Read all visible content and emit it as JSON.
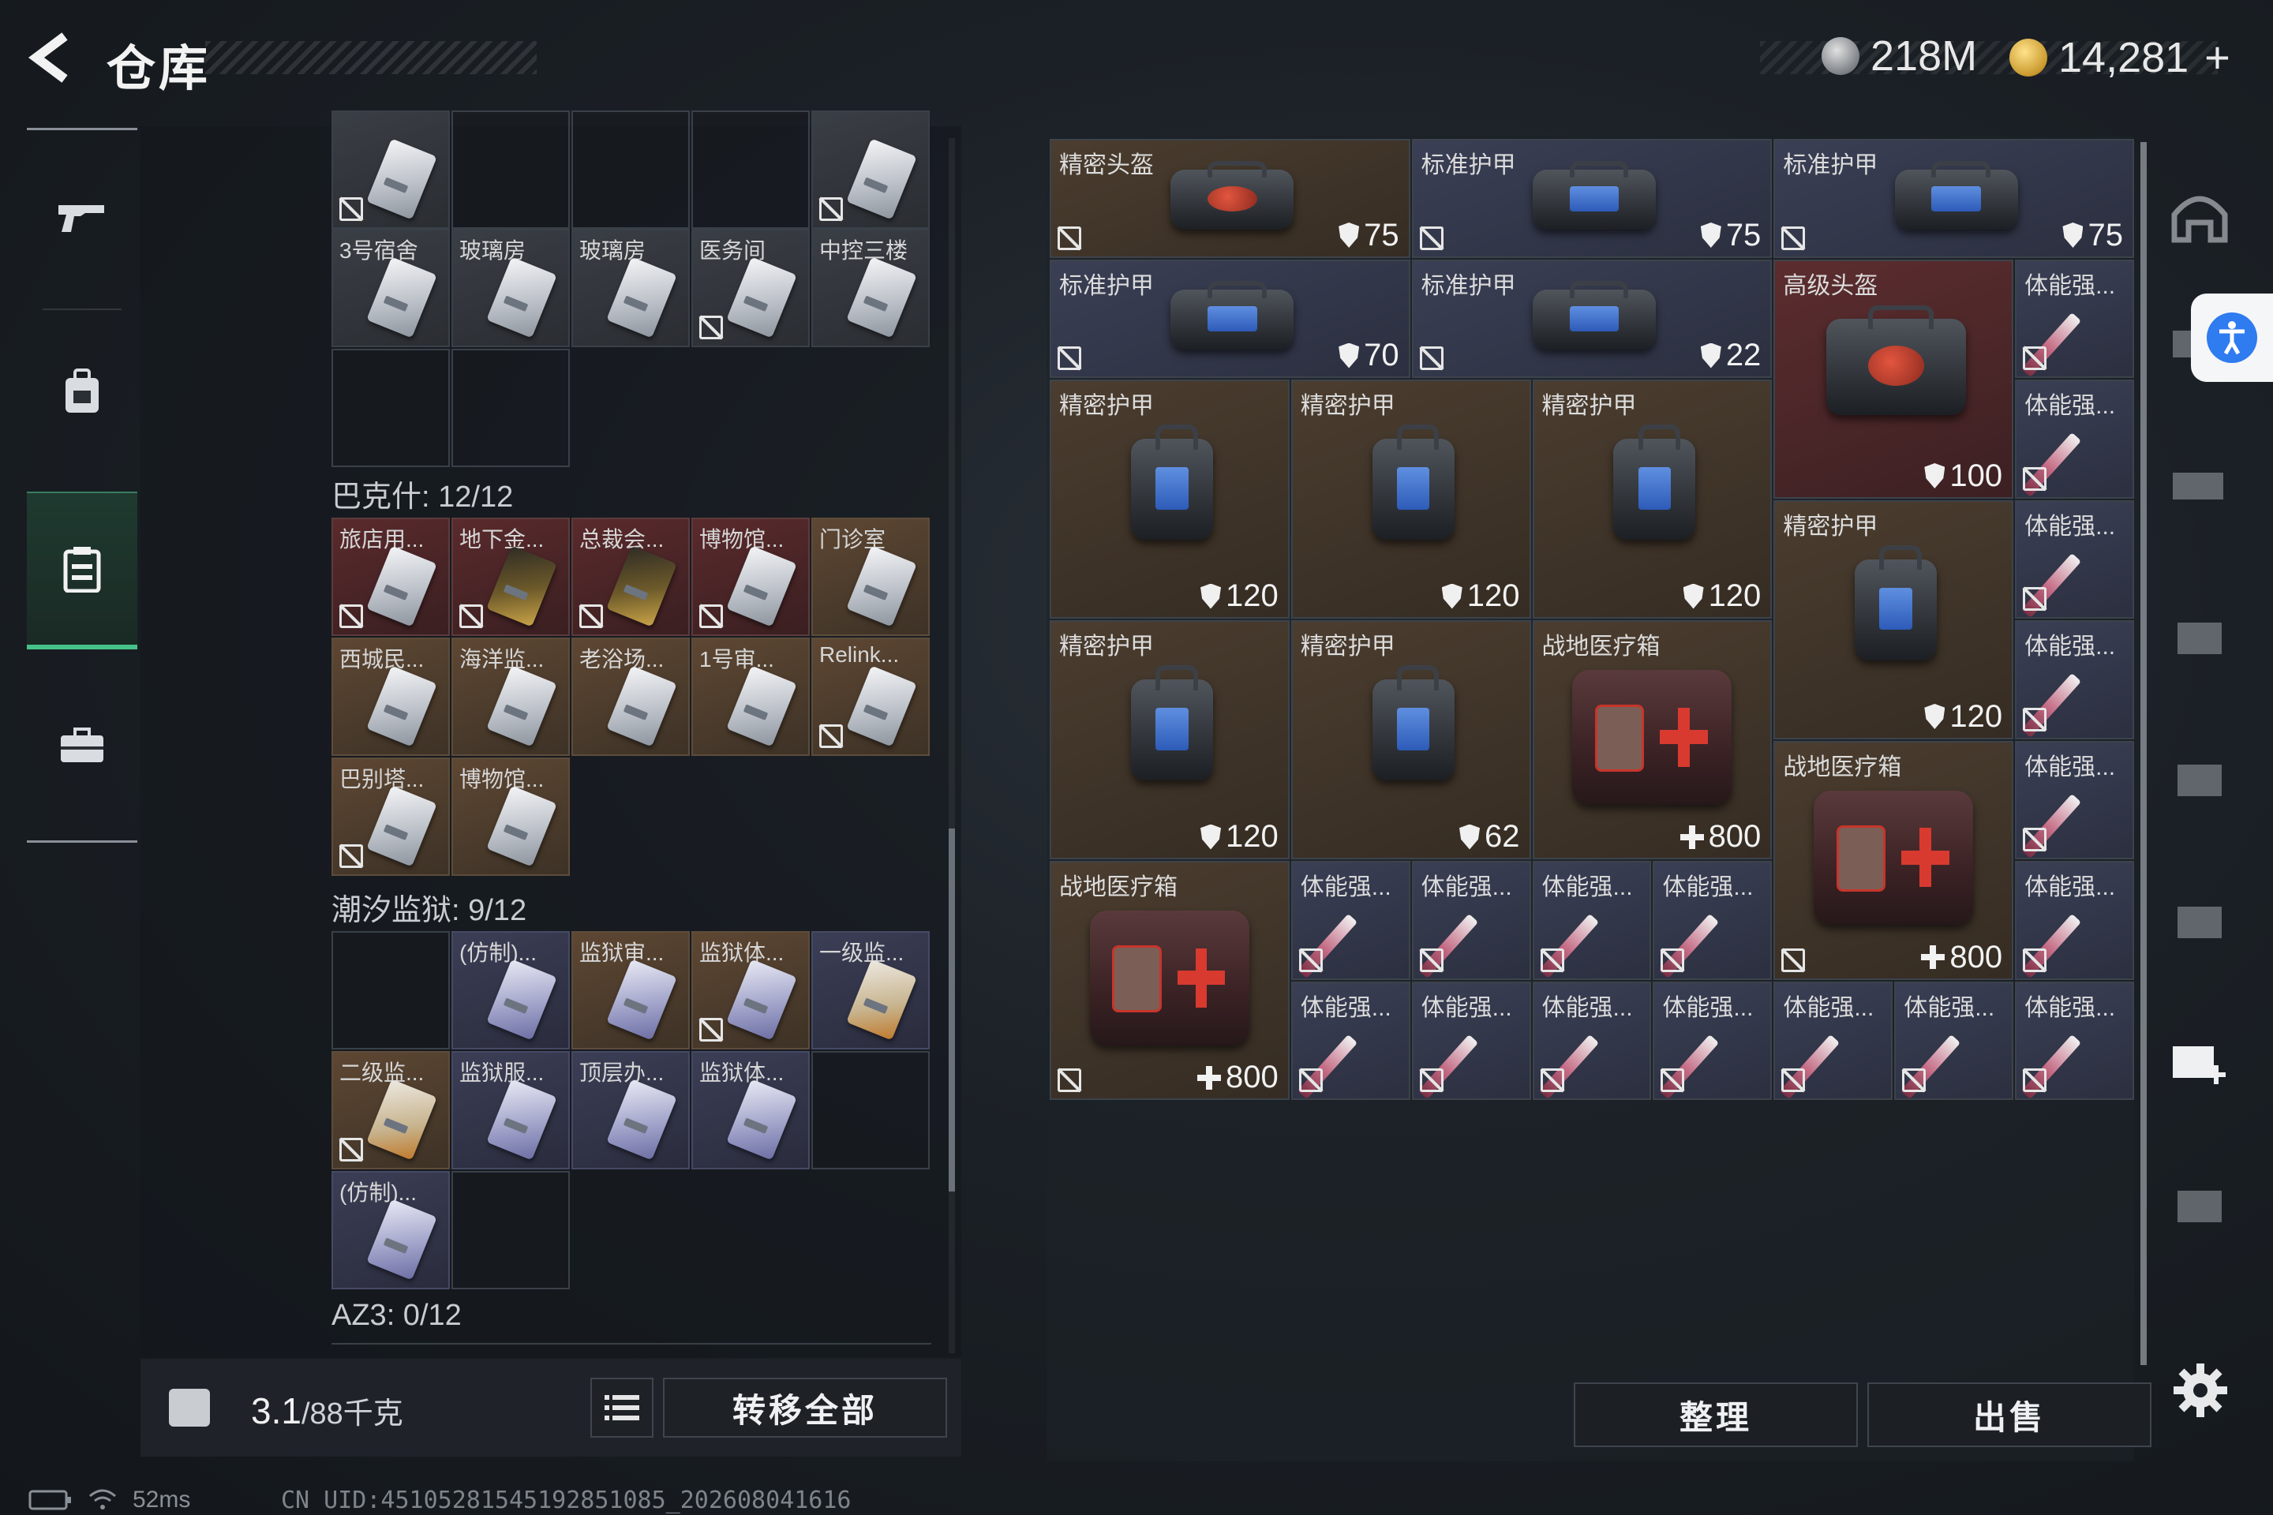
{
  "header": {
    "title": "仓库",
    "silver_amount": "218M",
    "gold_amount": "14,281",
    "plus_label": "+"
  },
  "left_nav": {
    "items": [
      {
        "icon": "gun-icon"
      },
      {
        "icon": "backpack-icon"
      },
      {
        "icon": "storage-icon",
        "active": true
      },
      {
        "icon": "briefcase-icon"
      }
    ]
  },
  "storage": {
    "top_cards": [
      {
        "label": "",
        "tint": "gray"
      },
      {
        "label": "",
        "tint": "empty"
      },
      {
        "label": "",
        "tint": "empty"
      },
      {
        "label": "",
        "tint": "empty"
      },
      {
        "label": "",
        "tint": "gray"
      },
      {
        "label": "3号宿舍",
        "tint": "gray"
      },
      {
        "label": "玻璃房",
        "tint": "gray"
      },
      {
        "label": "玻璃房",
        "tint": "gray"
      },
      {
        "label": "医务间",
        "tint": "gray"
      },
      {
        "label": "中控三楼",
        "tint": "gray"
      }
    ],
    "sections": [
      {
        "name": "巴克什: 12/12",
        "cards": [
          "旅店用...",
          "地下金...",
          "总裁会...",
          "博物馆...",
          "门诊室",
          "西城民...",
          "海洋监...",
          "老浴场...",
          "1号审...",
          "Relink...",
          "巴别塔...",
          "博物馆..."
        ]
      },
      {
        "name": "潮汐监狱: 9/12",
        "cards": [
          "(仿制)...",
          "监狱审...",
          "监狱体...",
          "一级监...",
          "二级监...",
          "监狱服...",
          "顶层办...",
          "监狱体...",
          "(仿制)..."
        ]
      },
      {
        "name": "AZ3: 0/12",
        "cards": []
      }
    ],
    "weight": "3.1",
    "weight_max": "/88千克",
    "transfer_all": "转移全部"
  },
  "status": {
    "ping": "52ms",
    "uid": "CN UID:4510528154519285108​5_202608041616"
  },
  "items": [
    {
      "label": "精密头盔",
      "value": "75",
      "kind": "shield",
      "tint": "brown"
    },
    {
      "label": "标准护甲",
      "value": "75",
      "kind": "shield",
      "tint": "blue"
    },
    {
      "label": "标准护甲",
      "value": "75",
      "kind": "shield",
      "tint": "blue"
    },
    {
      "label": "标准护甲",
      "value": "70",
      "kind": "shield",
      "tint": "blue"
    },
    {
      "label": "标准护甲",
      "value": "22",
      "kind": "shield",
      "tint": "blue"
    },
    {
      "label": "高级头盔",
      "value": "100",
      "kind": "shield",
      "tint": "red"
    },
    {
      "label": "精密护甲",
      "value": "120",
      "kind": "shield",
      "tint": "brown"
    },
    {
      "label": "精密护甲",
      "value": "120",
      "kind": "shield",
      "tint": "brown"
    },
    {
      "label": "精密护甲",
      "value": "120",
      "kind": "shield",
      "tint": "brown"
    },
    {
      "label": "精密护甲",
      "value": "120",
      "kind": "shield",
      "tint": "brown"
    },
    {
      "label": "精密护甲",
      "value": "120",
      "kind": "shield",
      "tint": "brown"
    },
    {
      "label": "精密护甲",
      "value": "62",
      "kind": "shield",
      "tint": "brown"
    },
    {
      "label": "战地医疗箱",
      "value": "800",
      "kind": "med",
      "tint": "brown"
    },
    {
      "label": "战地医疗箱",
      "value": "800",
      "kind": "med",
      "tint": "brown"
    },
    {
      "label": "战地医疗箱",
      "value": "800",
      "kind": "med",
      "tint": "brown"
    },
    {
      "label": "体能强...",
      "value": "",
      "kind": "syringe",
      "tint": "blue"
    }
  ],
  "actions": {
    "organize": "整理",
    "sell": "出售"
  }
}
